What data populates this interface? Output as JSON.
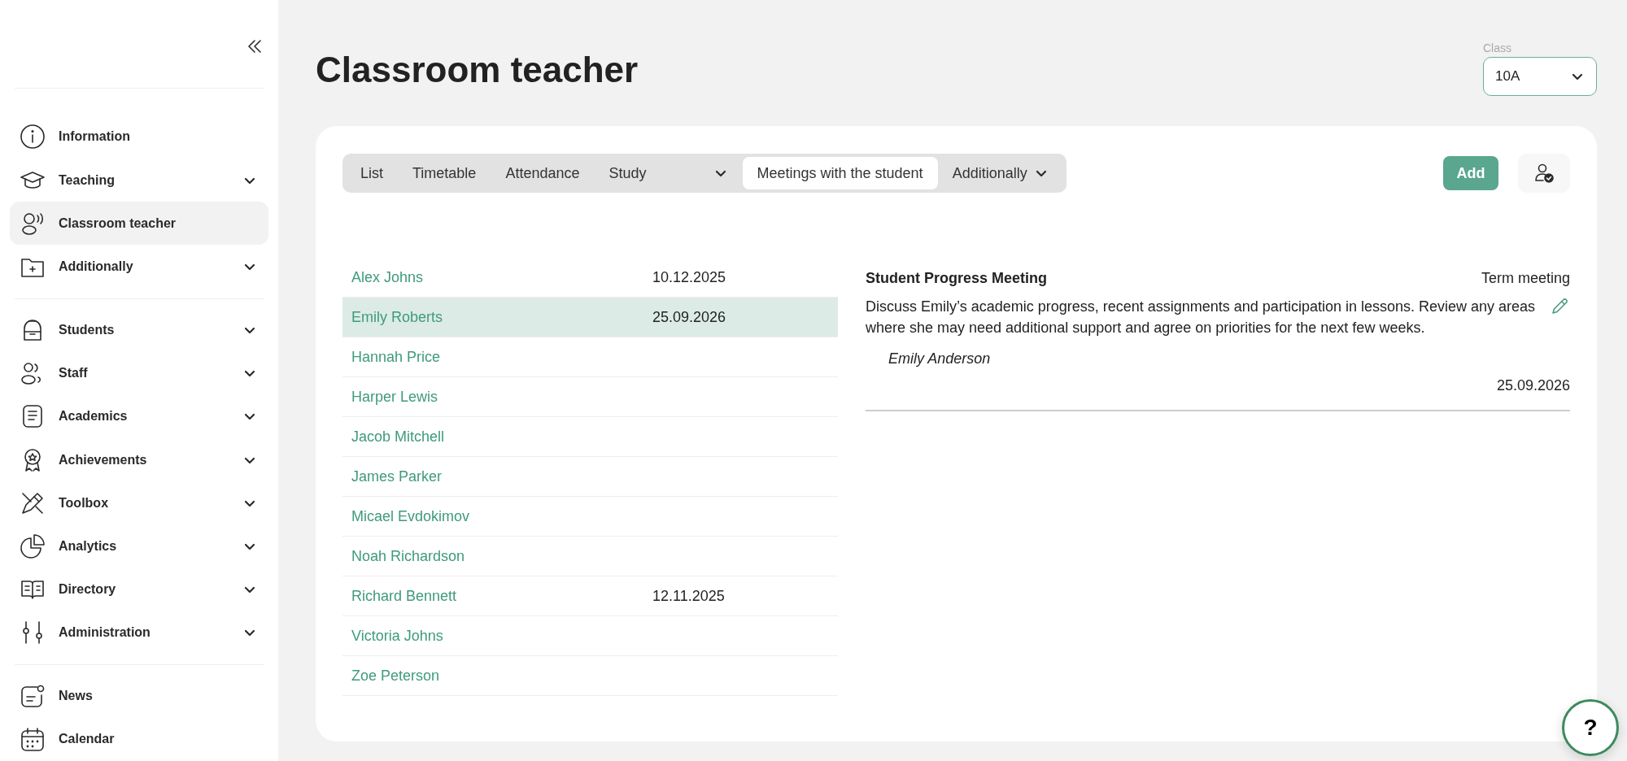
{
  "sidebar": {
    "sections": [
      {
        "items": [
          {
            "label": "Information",
            "expandable": false,
            "selected": false
          },
          {
            "label": "Teaching",
            "expandable": true,
            "selected": false
          },
          {
            "label": "Classroom teacher",
            "expandable": false,
            "selected": true
          },
          {
            "label": "Additionally",
            "expandable": true,
            "selected": false
          }
        ]
      },
      {
        "items": [
          {
            "label": "Students",
            "expandable": true,
            "selected": false
          },
          {
            "label": "Staff",
            "expandable": true,
            "selected": false
          },
          {
            "label": "Academics",
            "expandable": true,
            "selected": false
          },
          {
            "label": "Achievements",
            "expandable": true,
            "selected": false
          },
          {
            "label": "Toolbox",
            "expandable": true,
            "selected": false
          },
          {
            "label": "Analytics",
            "expandable": true,
            "selected": false
          },
          {
            "label": "Directory",
            "expandable": true,
            "selected": false
          },
          {
            "label": "Administration",
            "expandable": true,
            "selected": false
          }
        ]
      },
      {
        "items": [
          {
            "label": "News",
            "expandable": false,
            "selected": false
          },
          {
            "label": "Calendar",
            "expandable": false,
            "selected": false
          }
        ]
      }
    ]
  },
  "page": {
    "title": "Classroom teacher"
  },
  "class_select": {
    "label": "Class",
    "value": "10A"
  },
  "tabs": [
    {
      "label": "List",
      "dropdown": false,
      "selected": false
    },
    {
      "label": "Timetable",
      "dropdown": false,
      "selected": false
    },
    {
      "label": "Attendance",
      "dropdown": false,
      "selected": false
    },
    {
      "label": "Study",
      "dropdown": true,
      "selected": false
    },
    {
      "label": "Meetings with the student",
      "dropdown": false,
      "selected": true
    },
    {
      "label": "Additionally",
      "dropdown": true,
      "selected": false
    }
  ],
  "add_button": "Add",
  "students": [
    {
      "name": "Alex Johns",
      "date": "10.12.2025",
      "selected": false
    },
    {
      "name": "Emily Roberts",
      "date": "25.09.2026",
      "selected": true
    },
    {
      "name": "Hannah Price",
      "selected": false
    },
    {
      "name": "Harper Lewis",
      "selected": false
    },
    {
      "name": "Jacob Mitchell",
      "selected": false
    },
    {
      "name": "James Parker",
      "selected": false
    },
    {
      "name": "Micael Evdokimov",
      "selected": false
    },
    {
      "name": "Noah Richardson",
      "selected": false
    },
    {
      "name": "Richard Bennett",
      "date": "12.11.2025",
      "selected": false
    },
    {
      "name": "Victoria Johns",
      "selected": false
    },
    {
      "name": "Zoe Peterson",
      "selected": false
    }
  ],
  "meetings": [
    {
      "title": "Student Progress Meeting",
      "type": "Term meeting",
      "description": "Discuss Emily’s academic progress, recent assignments and participation in lessons. Review any areas where she may need additional support and agree on priorities for the next few weeks.",
      "author": "Emily Anderson",
      "date": "25.09.2026"
    }
  ],
  "help_button": "?"
}
